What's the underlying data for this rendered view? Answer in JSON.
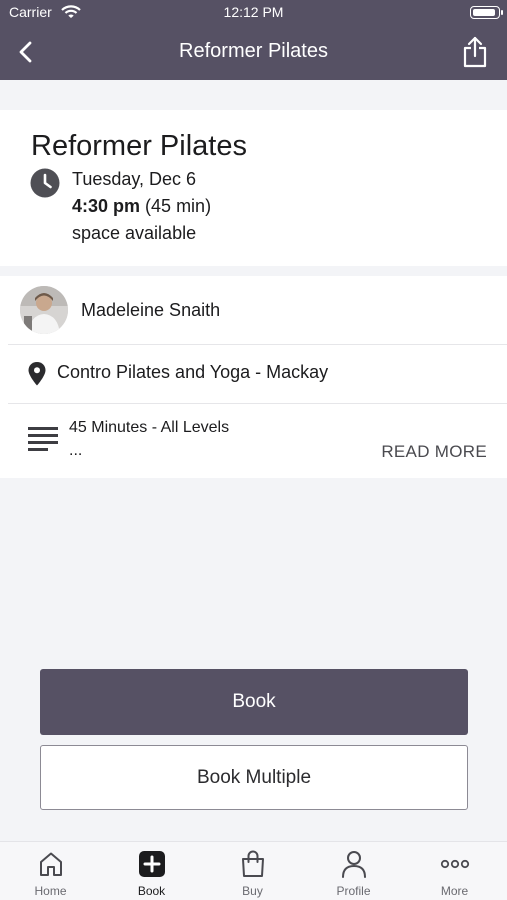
{
  "status_bar": {
    "carrier": "Carrier",
    "time": "12:12 PM",
    "battery_level": 0.95
  },
  "nav": {
    "title": "Reformer Pilates",
    "back_icon": "chevron-left-icon",
    "share_icon": "share-icon"
  },
  "class_info": {
    "title": "Reformer Pilates",
    "date": "Tuesday, Dec 6",
    "time": "4:30 pm",
    "duration": "(45 min)",
    "availability": "space available"
  },
  "instructor": {
    "name": "Madeleine Snaith"
  },
  "location": {
    "name": "Contro Pilates and Yoga - Mackay"
  },
  "description": {
    "text": "45 Minutes - All Levels",
    "ellipsis": "...",
    "read_more": "READ MORE"
  },
  "actions": {
    "book": "Book",
    "book_multiple": "Book Multiple"
  },
  "tabs": [
    {
      "label": "Home",
      "icon": "home-icon"
    },
    {
      "label": "Book",
      "icon": "plus-square-icon",
      "active": true
    },
    {
      "label": "Buy",
      "icon": "shopping-bag-icon"
    },
    {
      "label": "Profile",
      "icon": "user-icon"
    },
    {
      "label": "More",
      "icon": "more-dots-icon"
    }
  ],
  "colors": {
    "brand": "#565164",
    "background": "#f3f4f7"
  }
}
